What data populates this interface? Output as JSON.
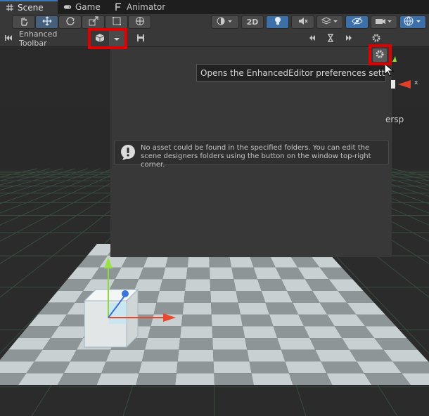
{
  "tabs": [
    {
      "label": "Scene",
      "icon": "grid-icon",
      "active": true
    },
    {
      "label": "Game",
      "icon": "gamepad-icon",
      "active": false
    },
    {
      "label": "Animator",
      "icon": "animator-icon",
      "active": false
    }
  ],
  "scene_toolbar": {
    "tools": [
      "hand-tool",
      "move-tool",
      "rotate-tool",
      "scale-tool",
      "rect-tool",
      "transform-tool"
    ],
    "mode_2d_label": "2D"
  },
  "enhanced_toolbar": {
    "title": "Enhanced Toolbar"
  },
  "help_box": {
    "message": "No asset could be found in the specified folders. You can edit the scene designers folders using the button on the window top-right corner."
  },
  "tooltip": {
    "text": "Opens the EnhancedEditor preferences settings"
  },
  "gizmo": {
    "axis_label": "x",
    "projection_label": "ersp"
  },
  "colors": {
    "accent": "#3a79bb",
    "highlight": "#e00000",
    "panel": "#383838"
  }
}
